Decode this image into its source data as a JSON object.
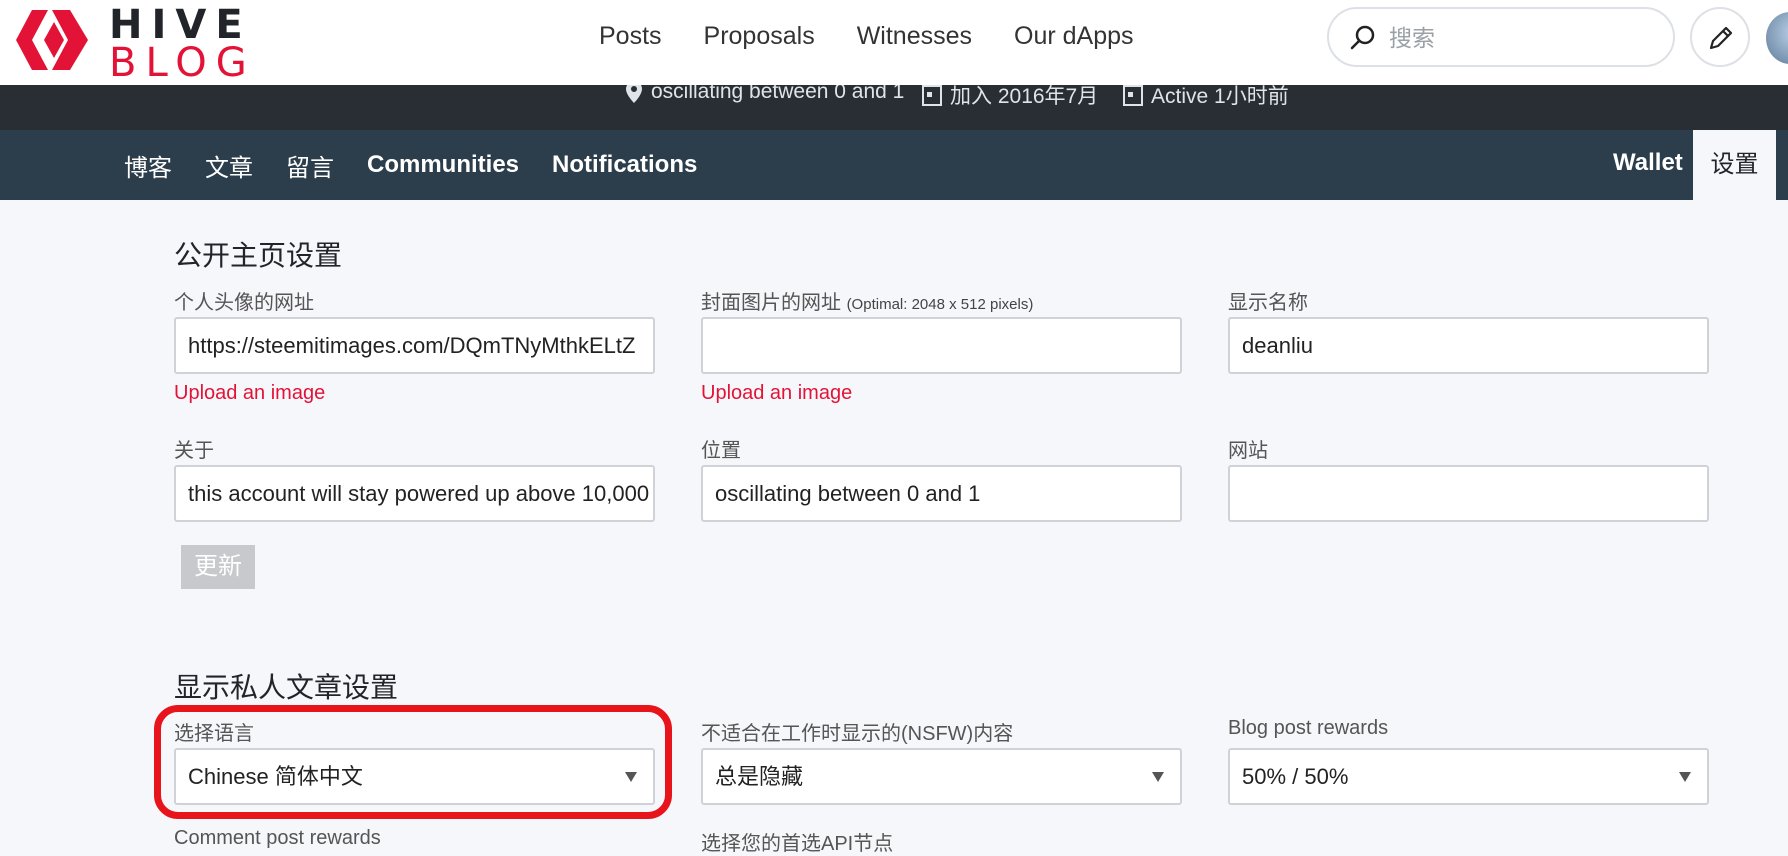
{
  "brand": {
    "line1": "HIVE",
    "line2": "BLOG",
    "accent": "#e31337"
  },
  "topnav": [
    "Posts",
    "Proposals",
    "Witnesses",
    "Our dApps"
  ],
  "search": {
    "placeholder": "搜索",
    "icon": "search-icon"
  },
  "header_actions": {
    "edit_icon": "pencil-icon",
    "avatar": "avatar"
  },
  "profile_meta": {
    "location": "oscillating between 0 and 1",
    "joined": "加入 2016年7月",
    "active": "Active 1小时前"
  },
  "tabs": {
    "left": [
      "博客",
      "文章",
      "留言",
      "Communities",
      "Notifications"
    ],
    "wallet": "Wallet",
    "settings": "设置"
  },
  "public_settings": {
    "title": "公开主页设置",
    "avatar_url": {
      "label": "个人头像的网址",
      "value": "https://steemitimages.com/DQmTNyMthkELtZ"
    },
    "cover_url": {
      "label": "封面图片的网址",
      "hint": "(Optimal: 2048 x 512 pixels)",
      "value": ""
    },
    "display_name": {
      "label": "显示名称",
      "value": "deanliu"
    },
    "upload_label": "Upload an image",
    "about": {
      "label": "关于",
      "value": "this account will stay powered up above 10,000"
    },
    "location": {
      "label": "位置",
      "value": "oscillating between 0 and 1"
    },
    "website": {
      "label": "网站",
      "value": ""
    },
    "update_button": "更新"
  },
  "private_settings": {
    "title": "显示私人文章设置",
    "language": {
      "label": "选择语言",
      "value": "Chinese 简体中文"
    },
    "nsfw": {
      "label": "不适合在工作时显示的(NSFW)内容",
      "value": "总是隐藏"
    },
    "blog_rewards": {
      "label": "Blog post rewards",
      "value": "50% / 50%"
    },
    "comment_rewards": {
      "label": "Comment post rewards"
    },
    "api_node": {
      "label": "选择您的首选API节点"
    }
  },
  "colors": {
    "profile_strip": "#282e34",
    "tabbar": "#2c3d4c",
    "highlight": "#e8141c"
  }
}
